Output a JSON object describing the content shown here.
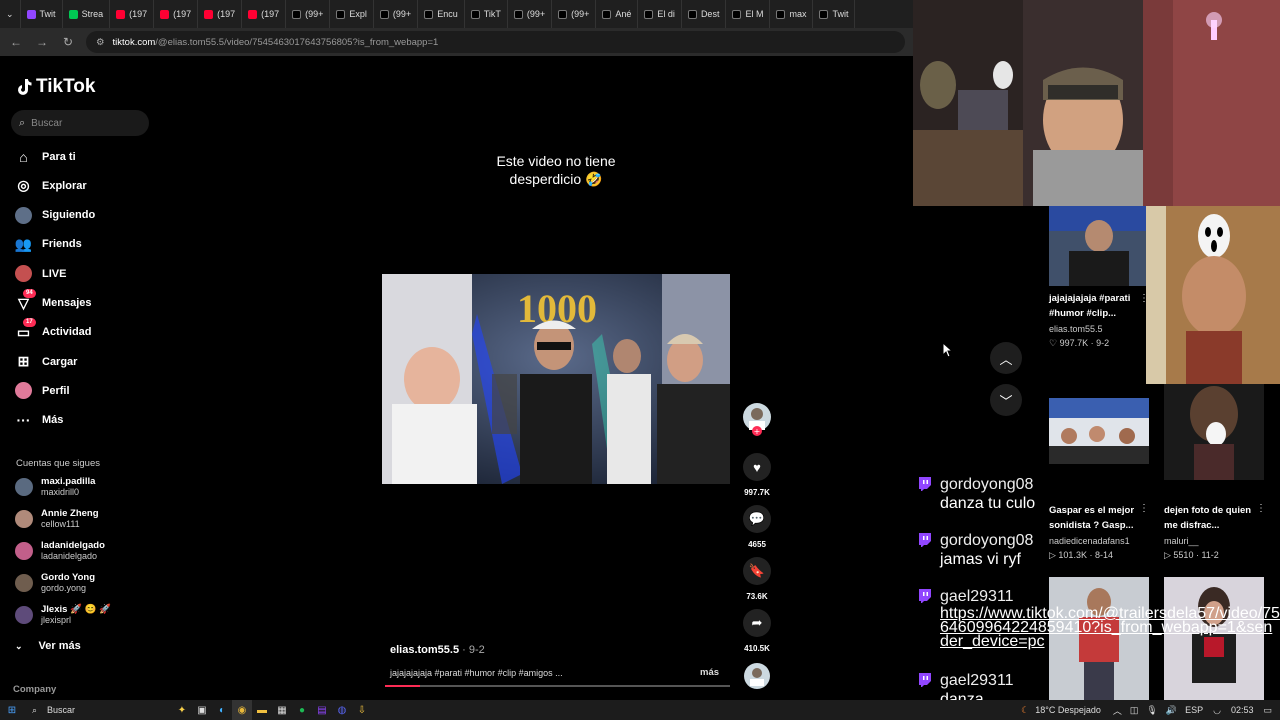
{
  "browser": {
    "tabs": [
      {
        "label": "Twit",
        "color": "#9146ff"
      },
      {
        "label": "Strea",
        "color": "#00c853"
      },
      {
        "label": "(197",
        "color": "#ff0033"
      },
      {
        "label": "(197",
        "color": "#ff0033"
      },
      {
        "label": "(197",
        "color": "#ff0033"
      },
      {
        "label": "(197",
        "color": "#ff0033"
      },
      {
        "label": "(99+",
        "color": "#000000"
      },
      {
        "label": "Expl",
        "color": "#000000"
      },
      {
        "label": "(99+",
        "color": "#000000"
      },
      {
        "label": "Encu",
        "color": "#000000"
      },
      {
        "label": "TikT",
        "color": "#000000"
      },
      {
        "label": "(99+",
        "color": "#000000"
      },
      {
        "label": "(99+",
        "color": "#000000"
      },
      {
        "label": "Ané",
        "color": "#000000"
      },
      {
        "label": "El di",
        "color": "#000000"
      },
      {
        "label": "Dest",
        "color": "#000000"
      },
      {
        "label": "El M",
        "color": "#000000"
      },
      {
        "label": "max",
        "color": "#000000"
      },
      {
        "label": "Twit",
        "color": "#000000"
      }
    ],
    "url_domain": "tiktok.com",
    "url_path": "/@elias.tom55.5/video/7545463017643756805?is_from_webapp=1"
  },
  "sidebar": {
    "logo": "TikTok",
    "search_placeholder": "Buscar",
    "nav": [
      {
        "label": "Para ti",
        "icon": "home-icon",
        "glyph": "⌂"
      },
      {
        "label": "Explorar",
        "icon": "compass-icon",
        "glyph": "◎"
      },
      {
        "label": "Siguiendo",
        "icon": "following-avatar",
        "glyph": ""
      },
      {
        "label": "Friends",
        "icon": "friends-icon",
        "glyph": "👥"
      },
      {
        "label": "LIVE",
        "icon": "live-avatar",
        "glyph": ""
      },
      {
        "label": "Mensajes",
        "icon": "messages-icon",
        "glyph": "▽",
        "badge": "94"
      },
      {
        "label": "Actividad",
        "icon": "activity-icon",
        "glyph": "▭",
        "badge": "17"
      },
      {
        "label": "Cargar",
        "icon": "upload-icon",
        "glyph": "⊞"
      },
      {
        "label": "Perfil",
        "icon": "profile-avatar",
        "glyph": ""
      },
      {
        "label": "Más",
        "icon": "more-icon",
        "glyph": "···"
      }
    ],
    "following_title": "Cuentas que sigues",
    "following": [
      {
        "name": "maxi.padilla",
        "user": "maxidrill0",
        "color": "#5a6a80"
      },
      {
        "name": "Annie Zheng",
        "user": "cellow111",
        "color": "#b08a7a"
      },
      {
        "name": "ladanidelgado",
        "user": "ladanidelgado",
        "color": "#c25f8a"
      },
      {
        "name": "Gordo Yong",
        "user": "gordo.yong",
        "color": "#6f5d4e"
      },
      {
        "name": "Jlexis 🚀 😊 🚀",
        "user": "jlexisprl",
        "color": "#5e4b7a"
      }
    ],
    "see_more": "Ver más",
    "company": "Company"
  },
  "video": {
    "caption_line1": "Este video no tiene",
    "caption_line2": "desperdicio 🤣",
    "author": "elias.tom55.5",
    "date": "· 9-2",
    "description": "jajajajajaja #parati #humor #clip #amigos ...",
    "more": "más",
    "progress": 0.1,
    "likes": "997.7K",
    "comments": "4655",
    "saves": "73.6K",
    "shares": "410.5K"
  },
  "recommendations": [
    {
      "title": "jajajajajaja #parati #humor #clip...",
      "user": "elias.tom55.5",
      "stats": "♡ 997.7K · 9-2"
    },
    {
      "title": "Gaspar es el mejor sonidista ? Gasp...",
      "user": "nadiedicenadafans1",
      "stats": "▷ 101.3K · 8-14"
    },
    {
      "title": "dejen foto de quien me disfrac...",
      "user": "maluri__",
      "stats": "▷ 5510 · 11-2"
    }
  ],
  "chat": [
    {
      "user": "gordoyong08",
      "message": "danza tu culo"
    },
    {
      "user": "gordoyong08",
      "message": "jamas vi ryf"
    },
    {
      "user": "gael29311",
      "message": "https://www.tiktok.com/@trailersdela57/video/7564609964224859410?is_from_webapp=1&sender_device=pc"
    },
    {
      "user": "gael29311",
      "message": "danza"
    }
  ],
  "taskbar": {
    "search": "Buscar",
    "weather": "18°C Despejado",
    "lang": "ESP",
    "time": "02:53"
  }
}
